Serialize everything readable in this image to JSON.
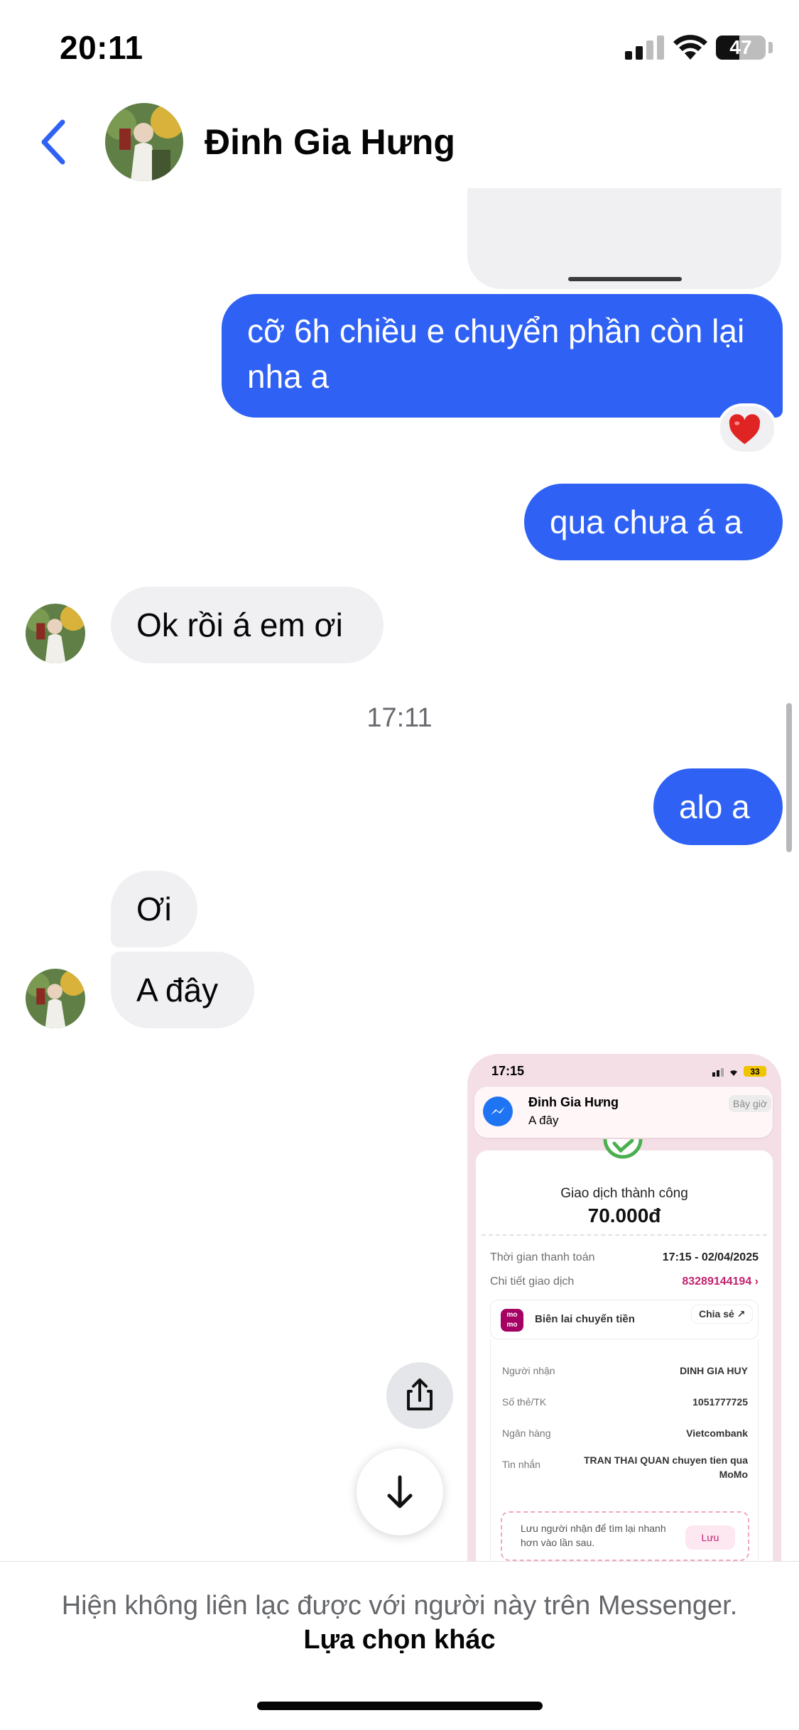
{
  "status_bar": {
    "time": "20:11",
    "battery": "47",
    "battery_level": 0.47
  },
  "header": {
    "back_icon": "chevron-left-icon",
    "contact_name": "Đinh Gia Hưng"
  },
  "messages": [
    {
      "sender": "me",
      "text": "cỡ 6h chiều e chuyển phần còn lại nha a",
      "reaction": "❤️"
    },
    {
      "sender": "me",
      "text": "qua chưa á a"
    },
    {
      "sender": "contact",
      "text": "Ok rồi á em ơi"
    },
    {
      "sender": "me",
      "text": "alo a"
    },
    {
      "sender": "contact",
      "text": "Ơi"
    },
    {
      "sender": "contact",
      "text": "A đây"
    }
  ],
  "timestamp": "17:11",
  "shared_screenshot": {
    "status_time": "17:15",
    "status_battery": "33",
    "notification": {
      "name": "Đinh Gia Hưng",
      "message": "A đây",
      "time": "Bây giờ"
    },
    "success_title": "Giao dịch thành công",
    "amount": "70.000đ",
    "rows": [
      {
        "label": "Thời gian thanh toán",
        "value": "17:15 - 02/04/2025"
      },
      {
        "label": "Chi tiết giao dịch",
        "value": "83289144194 ›"
      }
    ],
    "receipt": {
      "logo": "momo",
      "title": "Biên lai chuyển tiền",
      "share": "Chia sẻ ↗"
    },
    "details": [
      {
        "label": "Người nhận",
        "value": "DINH GIA HUY"
      },
      {
        "label": "Số thẻ/TK",
        "value": "1051777725"
      },
      {
        "label": "Ngân hàng",
        "value": "Vietcombank"
      },
      {
        "label": "Tin nhắn",
        "value": "TRAN THAI QUAN chuyen tien qua MoMo"
      }
    ],
    "save_hint": "Lưu người nhận để tìm lại nhanh hơn vào lần sau.",
    "save_button": "Lưu"
  },
  "floating": {
    "share_icon": "share-icon",
    "scroll_down_icon": "arrow-down-icon"
  },
  "footer": {
    "text": "Hiện không liên lạc được với người này trên Messenger.",
    "link": "Lựa chọn khác"
  },
  "colors": {
    "outgoing": "#2f62f4",
    "incoming": "#f0f0f3",
    "accent": "#1e74f2",
    "momo": "#a50064"
  }
}
